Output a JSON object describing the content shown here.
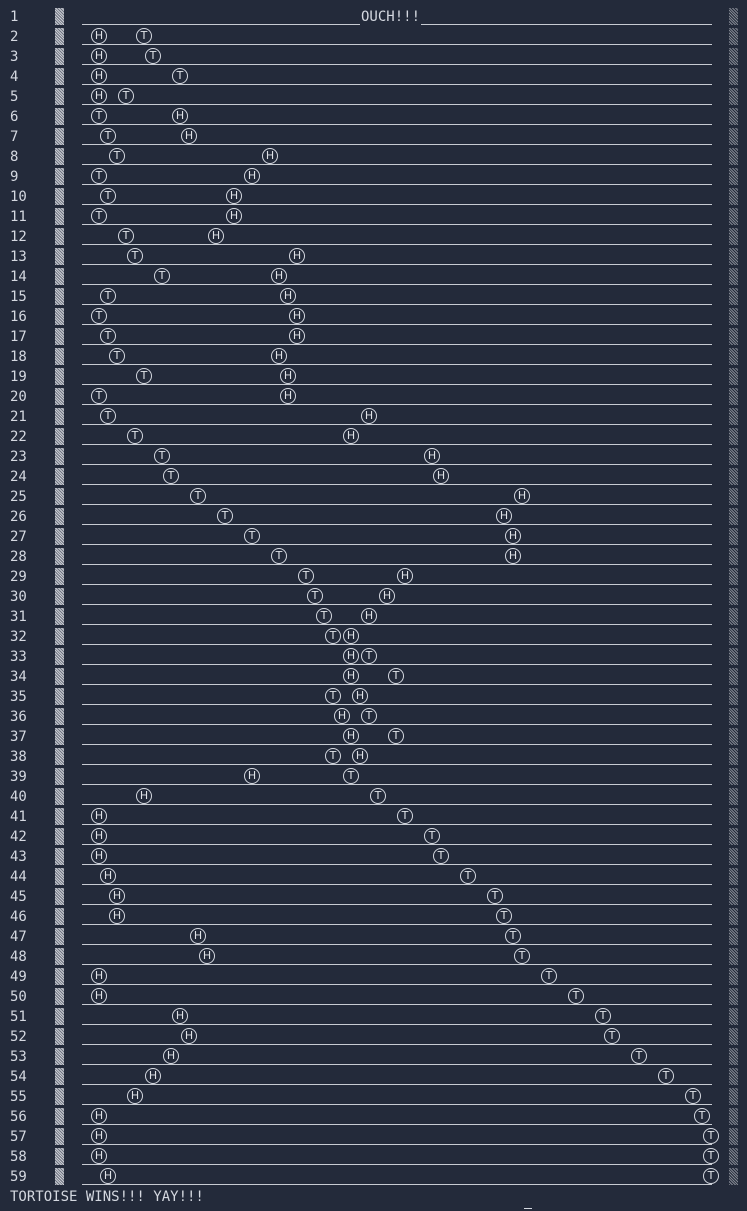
{
  "rows": [
    {
      "line_number": "1",
      "text": "OUCH!!!",
      "tokens": []
    },
    {
      "line_number": "2",
      "tokens": [
        {
          "label": "H",
          "column": 2
        },
        {
          "label": "T",
          "column": 7
        }
      ]
    },
    {
      "line_number": "3",
      "tokens": [
        {
          "label": "H",
          "column": 2
        },
        {
          "label": "T",
          "column": 8
        }
      ]
    },
    {
      "line_number": "4",
      "tokens": [
        {
          "label": "H",
          "column": 2
        },
        {
          "label": "T",
          "column": 11
        }
      ]
    },
    {
      "line_number": "5",
      "tokens": [
        {
          "label": "H",
          "column": 2
        },
        {
          "label": "T",
          "column": 5
        }
      ]
    },
    {
      "line_number": "6",
      "tokens": [
        {
          "label": "T",
          "column": 2
        },
        {
          "label": "H",
          "column": 11
        }
      ]
    },
    {
      "line_number": "7",
      "tokens": [
        {
          "label": "T",
          "column": 3
        },
        {
          "label": "H",
          "column": 12
        }
      ]
    },
    {
      "line_number": "8",
      "tokens": [
        {
          "label": "T",
          "column": 4
        },
        {
          "label": "H",
          "column": 21
        }
      ]
    },
    {
      "line_number": "9",
      "tokens": [
        {
          "label": "T",
          "column": 2
        },
        {
          "label": "H",
          "column": 19
        }
      ]
    },
    {
      "line_number": "10",
      "tokens": [
        {
          "label": "T",
          "column": 3
        },
        {
          "label": "H",
          "column": 17
        }
      ]
    },
    {
      "line_number": "11",
      "tokens": [
        {
          "label": "T",
          "column": 2
        },
        {
          "label": "H",
          "column": 17
        }
      ]
    },
    {
      "line_number": "12",
      "tokens": [
        {
          "label": "T",
          "column": 5
        },
        {
          "label": "H",
          "column": 15
        }
      ]
    },
    {
      "line_number": "13",
      "tokens": [
        {
          "label": "T",
          "column": 6
        },
        {
          "label": "H",
          "column": 24
        }
      ]
    },
    {
      "line_number": "14",
      "tokens": [
        {
          "label": "T",
          "column": 9
        },
        {
          "label": "H",
          "column": 22
        }
      ]
    },
    {
      "line_number": "15",
      "tokens": [
        {
          "label": "T",
          "column": 3
        },
        {
          "label": "H",
          "column": 23
        }
      ]
    },
    {
      "line_number": "16",
      "tokens": [
        {
          "label": "T",
          "column": 2
        },
        {
          "label": "H",
          "column": 24
        }
      ]
    },
    {
      "line_number": "17",
      "tokens": [
        {
          "label": "T",
          "column": 3
        },
        {
          "label": "H",
          "column": 24
        }
      ]
    },
    {
      "line_number": "18",
      "tokens": [
        {
          "label": "T",
          "column": 4
        },
        {
          "label": "H",
          "column": 22
        }
      ]
    },
    {
      "line_number": "19",
      "tokens": [
        {
          "label": "T",
          "column": 7
        },
        {
          "label": "H",
          "column": 23
        }
      ]
    },
    {
      "line_number": "20",
      "tokens": [
        {
          "label": "T",
          "column": 2
        },
        {
          "label": "H",
          "column": 23
        }
      ]
    },
    {
      "line_number": "21",
      "tokens": [
        {
          "label": "T",
          "column": 3
        },
        {
          "label": "H",
          "column": 32
        }
      ]
    },
    {
      "line_number": "22",
      "tokens": [
        {
          "label": "T",
          "column": 6
        },
        {
          "label": "H",
          "column": 30
        }
      ]
    },
    {
      "line_number": "23",
      "tokens": [
        {
          "label": "T",
          "column": 9
        },
        {
          "label": "H",
          "column": 39
        }
      ]
    },
    {
      "line_number": "24",
      "tokens": [
        {
          "label": "T",
          "column": 10
        },
        {
          "label": "H",
          "column": 40
        }
      ]
    },
    {
      "line_number": "25",
      "tokens": [
        {
          "label": "T",
          "column": 13
        },
        {
          "label": "H",
          "column": 49
        }
      ]
    },
    {
      "line_number": "26",
      "tokens": [
        {
          "label": "T",
          "column": 16
        },
        {
          "label": "H",
          "column": 47
        }
      ]
    },
    {
      "line_number": "27",
      "tokens": [
        {
          "label": "T",
          "column": 19
        },
        {
          "label": "H",
          "column": 48
        }
      ]
    },
    {
      "line_number": "28",
      "tokens": [
        {
          "label": "T",
          "column": 22
        },
        {
          "label": "H",
          "column": 48
        }
      ]
    },
    {
      "line_number": "29",
      "tokens": [
        {
          "label": "T",
          "column": 25
        },
        {
          "label": "H",
          "column": 36
        }
      ]
    },
    {
      "line_number": "30",
      "tokens": [
        {
          "label": "T",
          "column": 26
        },
        {
          "label": "H",
          "column": 34
        }
      ]
    },
    {
      "line_number": "31",
      "tokens": [
        {
          "label": "T",
          "column": 27
        },
        {
          "label": "H",
          "column": 32
        }
      ]
    },
    {
      "line_number": "32",
      "tokens": [
        {
          "label": "T",
          "column": 28
        },
        {
          "label": "H",
          "column": 30
        }
      ]
    },
    {
      "line_number": "33",
      "tokens": [
        {
          "label": "H",
          "column": 30
        },
        {
          "label": "T",
          "column": 32
        }
      ]
    },
    {
      "line_number": "34",
      "tokens": [
        {
          "label": "H",
          "column": 30
        },
        {
          "label": "T",
          "column": 35
        }
      ]
    },
    {
      "line_number": "35",
      "tokens": [
        {
          "label": "T",
          "column": 28
        },
        {
          "label": "H",
          "column": 31
        }
      ]
    },
    {
      "line_number": "36",
      "tokens": [
        {
          "label": "H",
          "column": 29
        },
        {
          "label": "T",
          "column": 32
        }
      ]
    },
    {
      "line_number": "37",
      "tokens": [
        {
          "label": "H",
          "column": 30
        },
        {
          "label": "T",
          "column": 35
        }
      ]
    },
    {
      "line_number": "38",
      "tokens": [
        {
          "label": "T",
          "column": 28
        },
        {
          "label": "H",
          "column": 31
        }
      ]
    },
    {
      "line_number": "39",
      "tokens": [
        {
          "label": "H",
          "column": 19
        },
        {
          "label": "T",
          "column": 30
        }
      ]
    },
    {
      "line_number": "40",
      "tokens": [
        {
          "label": "H",
          "column": 7
        },
        {
          "label": "T",
          "column": 33
        }
      ]
    },
    {
      "line_number": "41",
      "tokens": [
        {
          "label": "H",
          "column": 2
        },
        {
          "label": "T",
          "column": 36
        }
      ]
    },
    {
      "line_number": "42",
      "tokens": [
        {
          "label": "H",
          "column": 2
        },
        {
          "label": "T",
          "column": 39
        }
      ]
    },
    {
      "line_number": "43",
      "tokens": [
        {
          "label": "H",
          "column": 2
        },
        {
          "label": "T",
          "column": 40
        }
      ]
    },
    {
      "line_number": "44",
      "tokens": [
        {
          "label": "H",
          "column": 3
        },
        {
          "label": "T",
          "column": 43
        }
      ]
    },
    {
      "line_number": "45",
      "tokens": [
        {
          "label": "H",
          "column": 4
        },
        {
          "label": "T",
          "column": 46
        }
      ]
    },
    {
      "line_number": "46",
      "tokens": [
        {
          "label": "H",
          "column": 4
        },
        {
          "label": "T",
          "column": 47
        }
      ]
    },
    {
      "line_number": "47",
      "tokens": [
        {
          "label": "H",
          "column": 13
        },
        {
          "label": "T",
          "column": 48
        }
      ]
    },
    {
      "line_number": "48",
      "tokens": [
        {
          "label": "H",
          "column": 14
        },
        {
          "label": "T",
          "column": 49
        }
      ]
    },
    {
      "line_number": "49",
      "tokens": [
        {
          "label": "H",
          "column": 2
        },
        {
          "label": "T",
          "column": 52
        }
      ]
    },
    {
      "line_number": "50",
      "tokens": [
        {
          "label": "H",
          "column": 2
        },
        {
          "label": "T",
          "column": 55
        }
      ]
    },
    {
      "line_number": "51",
      "tokens": [
        {
          "label": "H",
          "column": 11
        },
        {
          "label": "T",
          "column": 58
        }
      ]
    },
    {
      "line_number": "52",
      "tokens": [
        {
          "label": "H",
          "column": 12
        },
        {
          "label": "T",
          "column": 59
        }
      ]
    },
    {
      "line_number": "53",
      "tokens": [
        {
          "label": "H",
          "column": 10
        },
        {
          "label": "T",
          "column": 62
        }
      ]
    },
    {
      "line_number": "54",
      "tokens": [
        {
          "label": "H",
          "column": 8
        },
        {
          "label": "T",
          "column": 65
        }
      ]
    },
    {
      "line_number": "55",
      "tokens": [
        {
          "label": "H",
          "column": 6
        },
        {
          "label": "T",
          "column": 68
        }
      ]
    },
    {
      "line_number": "56",
      "tokens": [
        {
          "label": "H",
          "column": 2
        },
        {
          "label": "T",
          "column": 69
        }
      ]
    },
    {
      "line_number": "57",
      "tokens": [
        {
          "label": "H",
          "column": 2
        },
        {
          "label": "T",
          "column": 70
        }
      ]
    },
    {
      "line_number": "58",
      "tokens": [
        {
          "label": "H",
          "column": 2
        },
        {
          "label": "T",
          "column": 70
        }
      ]
    },
    {
      "line_number": "59",
      "tokens": [
        {
          "label": "H",
          "column": 3
        },
        {
          "label": "T",
          "column": 70
        }
      ]
    }
  ],
  "final_message": "TORTOISE WINS!!! YAY!!!"
}
